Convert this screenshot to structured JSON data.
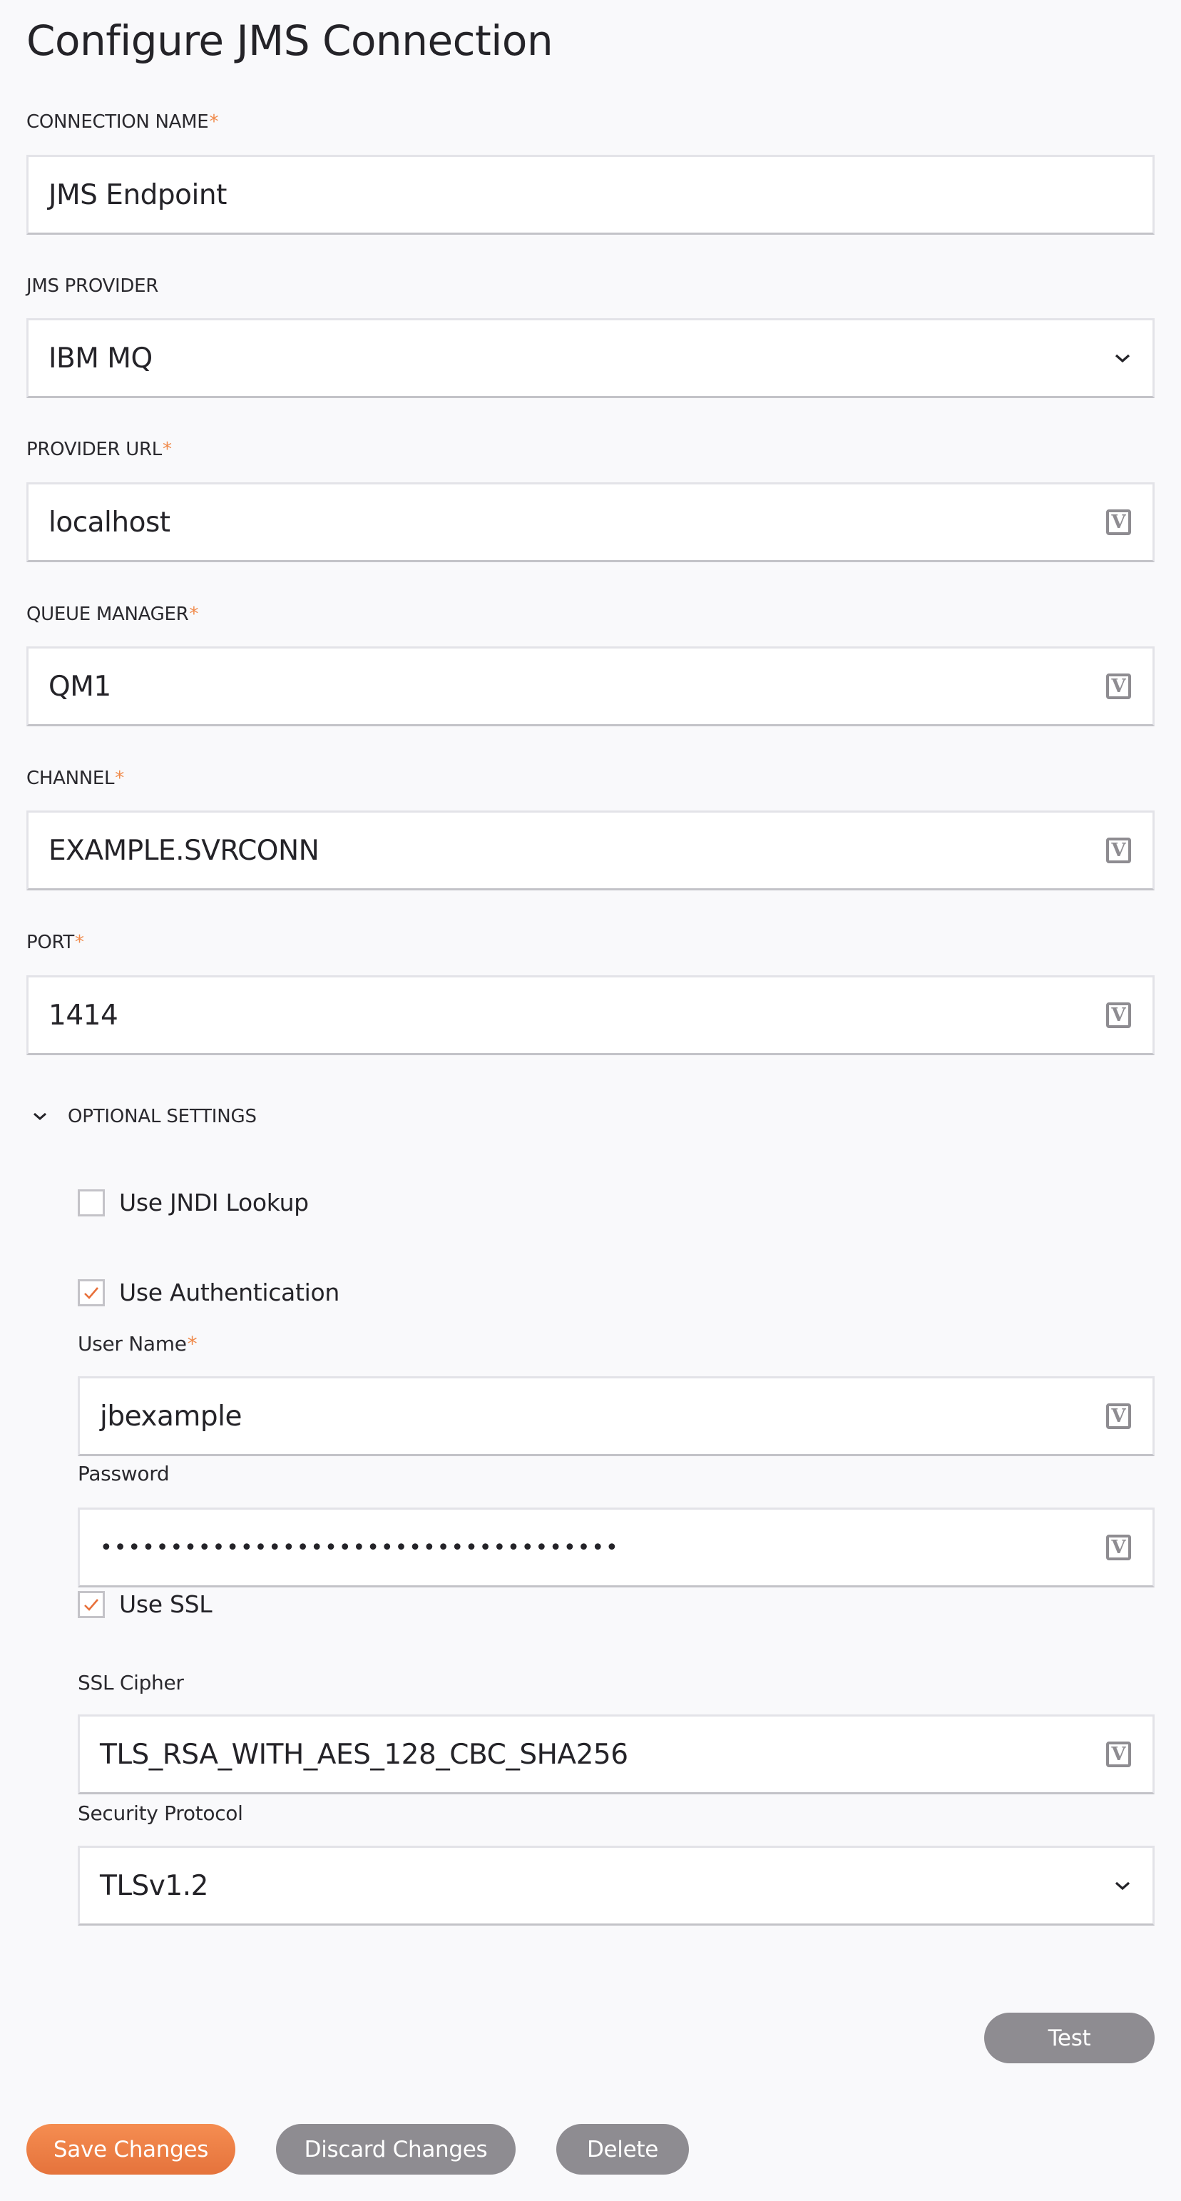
{
  "page": {
    "title": "Configure JMS Connection"
  },
  "fields": {
    "connection_name": {
      "label": "CONNECTION NAME",
      "required": "*",
      "value": "JMS Endpoint"
    },
    "jms_provider": {
      "label": "JMS PROVIDER",
      "value": "IBM MQ",
      "icon": "chevron-down-icon"
    },
    "provider_url": {
      "label": "PROVIDER URL",
      "required": "*",
      "value": "localhost",
      "icon": "variable-icon"
    },
    "queue_manager": {
      "label": "QUEUE MANAGER",
      "required": "*",
      "value": "QM1",
      "icon": "variable-icon"
    },
    "channel": {
      "label": "CHANNEL",
      "required": "*",
      "value": "EXAMPLE.SVRCONN",
      "icon": "variable-icon"
    },
    "port": {
      "label": "PORT",
      "required": "*",
      "value": "1414",
      "icon": "variable-icon"
    }
  },
  "variable_icon_glyph": "V",
  "optional_settings": {
    "label": "OPTIONAL SETTINGS",
    "expanded": true,
    "use_jndi_lookup": {
      "label": "Use JNDI Lookup",
      "checked": false
    },
    "use_authentication": {
      "label": "Use Authentication",
      "checked": true
    },
    "user_name": {
      "label": "User Name",
      "required": "*",
      "value": "jbexample",
      "icon": "variable-icon"
    },
    "password": {
      "label": "Password",
      "value": "•••••••••••••••••••••••••••••••••••••",
      "icon": "variable-icon"
    },
    "use_ssl": {
      "label": "Use SSL",
      "checked": true
    },
    "ssl_cipher": {
      "label": "SSL Cipher",
      "value": "TLS_RSA_WITH_AES_128_CBC_SHA256",
      "icon": "variable-icon"
    },
    "security_protocol": {
      "label": "Security Protocol",
      "value": "TLSv1.2",
      "icon": "chevron-down-icon"
    }
  },
  "buttons": {
    "test": "Test",
    "save": "Save Changes",
    "discard": "Discard Changes",
    "delete": "Delete"
  },
  "colors": {
    "accent": "#f08a4b",
    "button_gray": "#8e8c91",
    "background": "#f9f9fb"
  }
}
